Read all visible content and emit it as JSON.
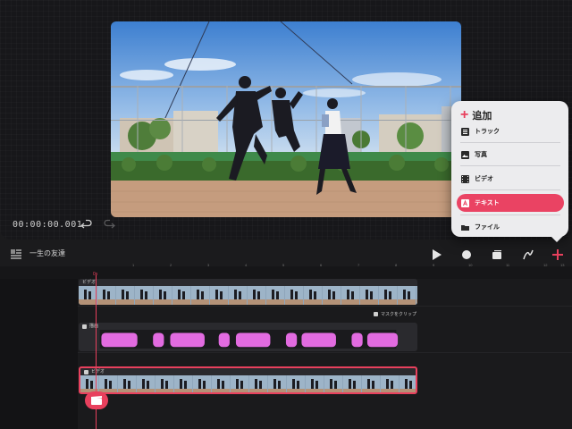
{
  "preview": {
    "timecode": "00:00:00.001",
    "undo_icon": "undo-icon",
    "redo_icon": "redo-icon"
  },
  "add_menu": {
    "title": "追加",
    "items": [
      {
        "label": "トラック",
        "icon": "track-icon"
      },
      {
        "label": "写真",
        "icon": "photo-icon"
      },
      {
        "label": "ビデオ",
        "icon": "video-icon"
      },
      {
        "label": "テキスト",
        "icon": "text-icon",
        "active": true
      },
      {
        "label": "ファイル",
        "icon": "folder-icon"
      }
    ]
  },
  "toolbar": {
    "project_title": "一生の友達",
    "buttons": [
      "play-icon",
      "record-icon",
      "layers-icon",
      "draw-icon",
      "add-icon"
    ]
  },
  "timeline": {
    "playhead_label": "0s",
    "ruler_labels": [
      "1",
      "2",
      "3",
      "4",
      "5",
      "6",
      "7",
      "8",
      "9",
      "10",
      "11",
      "12",
      "13"
    ],
    "tracks": [
      {
        "label": "ビデオ"
      },
      {
        "label": "描画"
      },
      {
        "label": "ビデオ"
      }
    ],
    "mask_clip_label": "マスクをクリップ"
  },
  "colors": {
    "accent": "#e8405d",
    "background": "#1b1b1d",
    "menu_bg": "#ececee"
  }
}
